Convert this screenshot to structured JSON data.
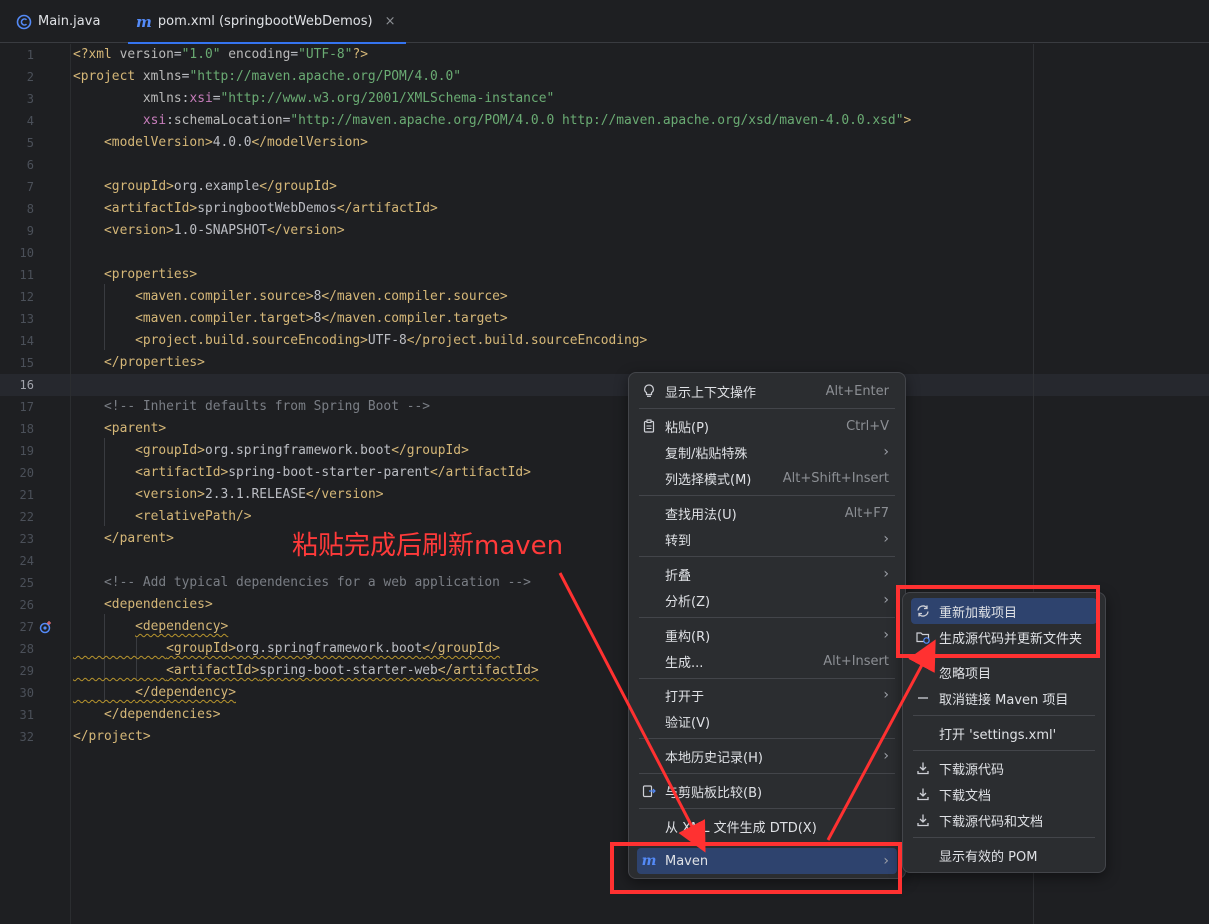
{
  "tabs": [
    {
      "label": "Main.java",
      "icon": "java-class-icon",
      "active": false
    },
    {
      "label": "pom.xml (springbootWebDemos)",
      "icon": "maven-icon",
      "active": true,
      "close": "×"
    }
  ],
  "editor": {
    "current_line": 16,
    "line_numbers": [
      "1",
      "2",
      "3",
      "4",
      "5",
      "6",
      "7",
      "8",
      "9",
      "10",
      "11",
      "12",
      "13",
      "14",
      "15",
      "16",
      "17",
      "18",
      "19",
      "20",
      "21",
      "22",
      "23",
      "24",
      "25",
      "26",
      "27",
      "28",
      "29",
      "30",
      "31",
      "32"
    ]
  },
  "annotation": {
    "text": "粘贴完成后刷新maven",
    "color": "#ff3a3a"
  },
  "context_menu": {
    "items": [
      {
        "label": "显示上下文操作",
        "shortcut": "Alt+Enter",
        "icon": "lightbulb-icon"
      },
      {
        "label": "粘贴(P)",
        "shortcut": "Ctrl+V",
        "icon": "clipboard-icon"
      },
      {
        "label": "复制/粘贴特殊",
        "submenu": true
      },
      {
        "label": "列选择模式(M)",
        "shortcut": "Alt+Shift+Insert"
      },
      {
        "label": "查找用法(U)",
        "shortcut": "Alt+F7"
      },
      {
        "label": "转到",
        "submenu": true
      },
      {
        "label": "折叠",
        "submenu": true
      },
      {
        "label": "分析(Z)",
        "submenu": true
      },
      {
        "label": "重构(R)",
        "submenu": true
      },
      {
        "label": "生成...",
        "shortcut": "Alt+Insert"
      },
      {
        "label": "打开于",
        "submenu": true
      },
      {
        "label": "验证(V)"
      },
      {
        "label": "本地历史记录(H)",
        "submenu": true
      },
      {
        "label": "与剪贴板比较(B)",
        "icon": "compare-icon"
      },
      {
        "label": "从 XML 文件生成 DTD(X)"
      },
      {
        "label": "Maven",
        "submenu": true,
        "icon": "maven-icon"
      }
    ]
  },
  "maven_submenu": {
    "items": [
      {
        "label": "重新加载项目",
        "icon": "reload-icon"
      },
      {
        "label": "生成源代码并更新文件夹",
        "icon": "folder-refresh-icon"
      },
      {
        "label": "忽略项目"
      },
      {
        "label": "取消链接 Maven 项目",
        "icon": "minus-icon"
      },
      {
        "label": "打开 'settings.xml'"
      },
      {
        "label": "下载源代码",
        "icon": "download-icon"
      },
      {
        "label": "下载文档",
        "icon": "download-icon"
      },
      {
        "label": "下载源代码和文档",
        "icon": "download-icon"
      },
      {
        "label": "显示有效的 POM"
      }
    ]
  },
  "colors": {
    "highlight": "#2e436e",
    "annotation_red": "#ff3131",
    "accent": "#3574f0"
  }
}
